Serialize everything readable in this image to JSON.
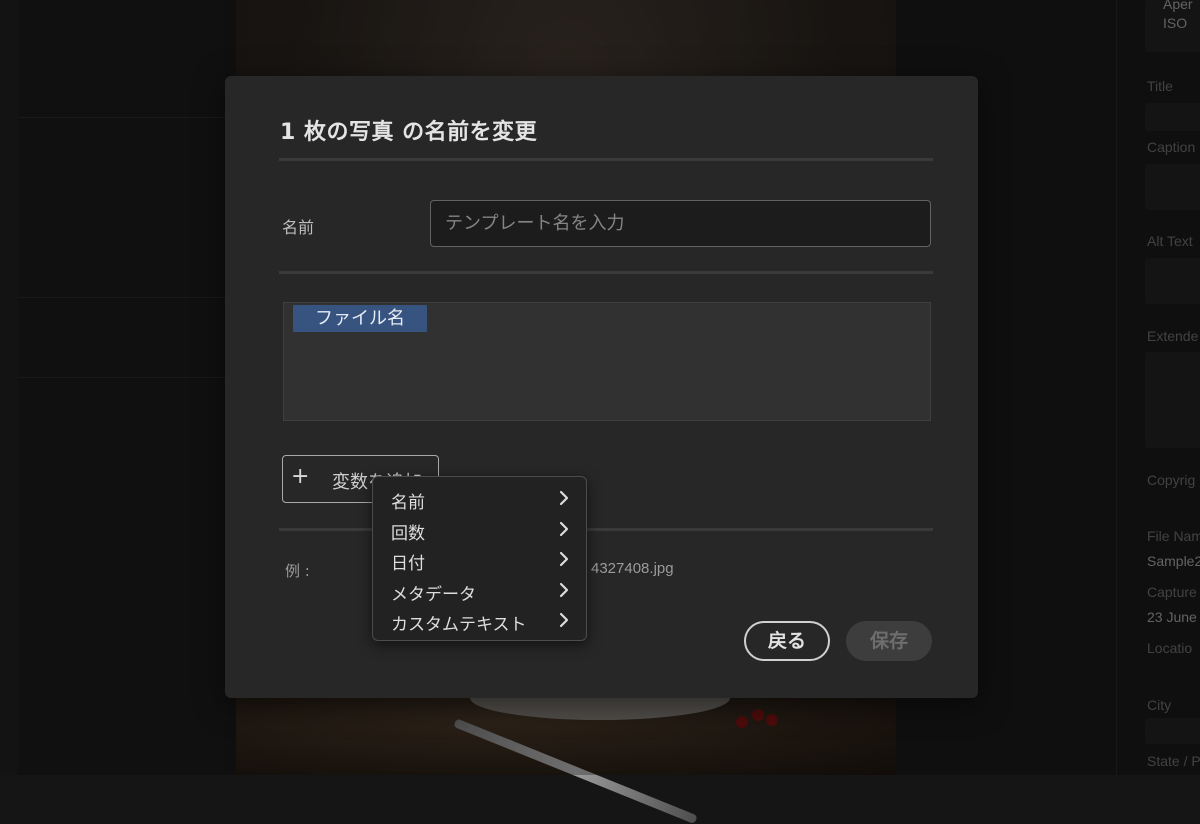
{
  "dialog": {
    "title": "1 枚の写真 の名前を変更",
    "name_label": "名前",
    "name_placeholder": "テンプレート名を入力",
    "token_label": "ファイル名",
    "add_variable_label": "変数を追加",
    "add_variable_icon": "plus-icon",
    "example_label": "例 :",
    "example_value": "4327408.jpg",
    "back_label": "戻る",
    "save_label": "保存"
  },
  "menu": {
    "items": [
      {
        "label": "名前",
        "icon": "chevron-right-icon"
      },
      {
        "label": "回数",
        "icon": "chevron-right-icon"
      },
      {
        "label": "日付",
        "icon": "chevron-right-icon"
      },
      {
        "label": "メタデータ",
        "icon": "chevron-right-icon"
      },
      {
        "label": "カスタムテキスト",
        "icon": "chevron-right-icon"
      }
    ]
  },
  "right_panel": {
    "top_labels": [
      "Aper",
      "ISO"
    ],
    "title_label": "Title",
    "caption_label": "Caption",
    "alt_text_label": "Alt Text",
    "extended_label": "Extende",
    "copyright_label": "Copyrig",
    "file_name_label": "File Nam",
    "file_name_value": "Sample2",
    "capture_label": "Capture",
    "capture_value": "23 June",
    "location_label": "Locatio",
    "city_label": "City",
    "state_label": "State / P"
  },
  "colors": {
    "dialog_bg": "#272727",
    "token_bg": "#375481",
    "app_bg": "#151515"
  }
}
